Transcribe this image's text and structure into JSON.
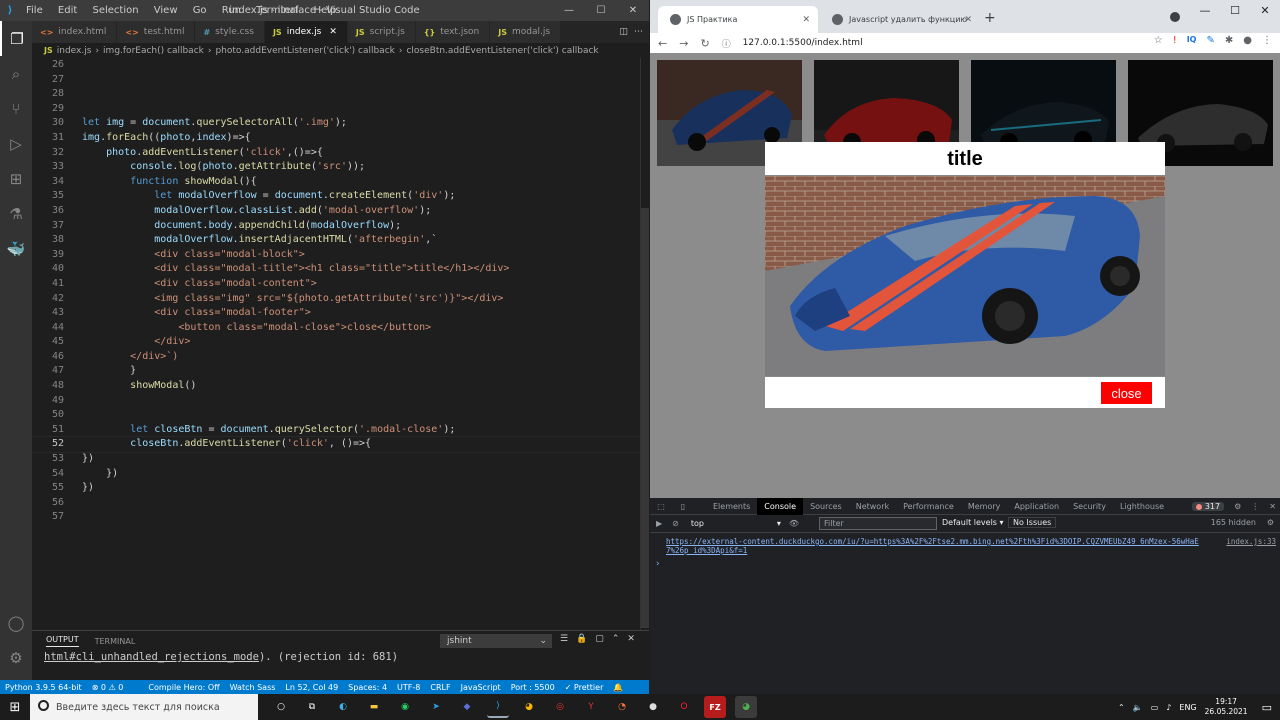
{
  "vscode": {
    "window_title": "index.js - iterface - Visual Studio Code",
    "menu": [
      "File",
      "Edit",
      "Selection",
      "View",
      "Go",
      "Run",
      "Terminal",
      "Help"
    ],
    "tabs": [
      {
        "icon": "<>",
        "label": "index.html",
        "color": "#e37933"
      },
      {
        "icon": "<>",
        "label": "test.html",
        "color": "#e37933"
      },
      {
        "icon": "#",
        "label": "style.css",
        "color": "#519aba"
      },
      {
        "icon": "JS",
        "label": "index.js",
        "color": "#cbcb41"
      },
      {
        "icon": "JS",
        "label": "script.js",
        "color": "#cbcb41"
      },
      {
        "icon": "{}",
        "label": "text.json",
        "color": "#cbcb41"
      },
      {
        "icon": "JS",
        "label": "modal.js",
        "color": "#cbcb41"
      }
    ],
    "breadcrumb": [
      "index.js",
      "img.forEach() callback",
      "photo.addEventListener('click') callback",
      "closeBtn.addEventListener('click') callback"
    ],
    "code_lines": [
      {
        "n": "26",
        "t": ""
      },
      {
        "n": "27",
        "t": ""
      },
      {
        "n": "28",
        "t": ""
      },
      {
        "n": "29",
        "t": ""
      },
      {
        "n": "30",
        "t": "let img = document.querySelectorAll('.img');"
      },
      {
        "n": "31",
        "t": "img.forEach((photo,index)=>{"
      },
      {
        "n": "32",
        "t": "    photo.addEventListener('click',()=>{"
      },
      {
        "n": "33",
        "t": "        console.log(photo.getAttribute('src'));"
      },
      {
        "n": "34",
        "t": "        function showModal(){"
      },
      {
        "n": "35",
        "t": "            let modalOverflow = document.createElement('div');"
      },
      {
        "n": "36",
        "t": "            modalOverflow.classList.add('modal-overflow');"
      },
      {
        "n": "37",
        "t": "            document.body.appendChild(modalOverflow);"
      },
      {
        "n": "38",
        "t": "            modalOverflow.insertAdjacentHTML('afterbegin',`"
      },
      {
        "n": "39",
        "t": "            <div class=\"modal-block\">"
      },
      {
        "n": "40",
        "t": "            <div class=\"modal-title\"><h1 class=\"title\">title</h1></div>"
      },
      {
        "n": "41",
        "t": "            <div class=\"modal-content\">"
      },
      {
        "n": "42",
        "t": "            <img class=\"img\" src=\"${photo.getAttribute('src')}\"></div>"
      },
      {
        "n": "43",
        "t": "            <div class=\"modal-footer\">"
      },
      {
        "n": "44",
        "t": "                <button class=\"modal-close\">close</button>"
      },
      {
        "n": "45",
        "t": "            </div>"
      },
      {
        "n": "46",
        "t": "        </div>`)"
      },
      {
        "n": "47",
        "t": "        }"
      },
      {
        "n": "48",
        "t": "        showModal()"
      },
      {
        "n": "49",
        "t": ""
      },
      {
        "n": "50",
        "t": ""
      },
      {
        "n": "51",
        "t": "        let closeBtn = document.querySelector('.modal-close');"
      },
      {
        "n": "52",
        "t": "        closeBtn.addEventListener('click', ()=>{"
      },
      {
        "n": "53",
        "t": "})"
      },
      {
        "n": "54",
        "t": "    })"
      },
      {
        "n": "55",
        "t": "})"
      },
      {
        "n": "56",
        "t": ""
      },
      {
        "n": "57",
        "t": ""
      }
    ],
    "panel": {
      "tab_output": "OUTPUT",
      "tab_terminal": "TERMINAL",
      "select_value": "jshint",
      "output_link": "html#cli_unhandled_rejections_mode",
      "output_rest": "). (rejection id: 681)"
    },
    "status": [
      "Python 3.9.5 64-bit",
      "⊗ 0 ⚠ 0",
      "Compile Hero: Off",
      "Watch Sass",
      "Ln 52, Col 49",
      "Spaces: 4",
      "UTF-8",
      "CRLF",
      "JavaScript",
      "Port : 5500",
      "✓ Prettier"
    ]
  },
  "chrome": {
    "tab1": "JS Практика",
    "tab2": "Javascript удалить функцию",
    "url": "127.0.0.1:5500/index.html",
    "modal_title": "title",
    "modal_close": "close",
    "devtools_tabs": [
      "Elements",
      "Console",
      "Sources",
      "Network",
      "Performance",
      "Memory",
      "Application",
      "Security",
      "Lighthouse"
    ],
    "error_count": "317",
    "context": "top",
    "filter_placeholder": "Filter",
    "levels": "Default levels ▾",
    "issues": "No Issues",
    "hidden": "165 hidden",
    "console_msg": "https://external-content.duckduckgo.com/iu/?u=https%3A%2F%2Ftse2.mm.bing.net%2Fth%3Fid%3DOIP.CQZVMEUbZ49_6nMzex-56wHaE7%26p id%3DApi&f=1",
    "console_src": "index.js:33"
  },
  "taskbar": {
    "search_placeholder": "Введите здесь текст для поиска",
    "lang": "ENG",
    "time": "19:17",
    "date": "26.05.2021"
  }
}
